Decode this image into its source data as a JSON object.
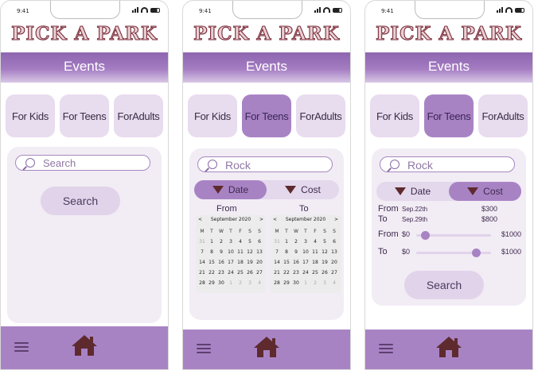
{
  "colors": {
    "header": "#a47cc2",
    "tab": "#e8dcef",
    "tab_active": "#a883c4",
    "card": "#f2ecf5",
    "footer": "#a883c4",
    "icon": "#5e2a2e"
  },
  "icons": [
    "search-icon",
    "triangle-down-icon",
    "menu-icon",
    "home-icon"
  ],
  "screens": [
    {
      "status_time": "9:41",
      "brand": "PICK A PARK",
      "header": "Events",
      "tabs": [
        "For Kids",
        "For Teens",
        "ForAdults"
      ],
      "active_tab": null,
      "search_value": "Search",
      "search_button": "Search"
    },
    {
      "status_time": "9:41",
      "brand": "PICK A PARK",
      "header": "Events",
      "tabs": [
        "For Kids",
        "For Teens",
        "ForAdults"
      ],
      "active_tab": 1,
      "search_value": "Rock",
      "filter": {
        "date": "Date",
        "cost": "Cost",
        "selected": "date"
      },
      "from_label": "From",
      "to_label": "To",
      "calendar": {
        "month": "September 2020",
        "weekdays": [
          "M",
          "T",
          "W",
          "T",
          "F",
          "S",
          "S"
        ],
        "days": [
          [
            "31",
            "1",
            "2",
            "3",
            "4",
            "5",
            "6"
          ],
          [
            "7",
            "8",
            "9",
            "10",
            "11",
            "12",
            "13"
          ],
          [
            "14",
            "15",
            "16",
            "17",
            "18",
            "19",
            "20"
          ],
          [
            "21",
            "22",
            "23",
            "24",
            "25",
            "26",
            "27"
          ],
          [
            "28",
            "29",
            "30",
            "1",
            "2",
            "3",
            "4"
          ]
        ]
      }
    },
    {
      "status_time": "9:41",
      "brand": "PICK A PARK",
      "header": "Events",
      "tabs": [
        "For Kids",
        "For Teens",
        "ForAdults"
      ],
      "active_tab": 1,
      "search_value": "Rock",
      "filter": {
        "date": "Date",
        "cost": "Cost",
        "selected": "cost"
      },
      "from_label": "From",
      "to_label": "To",
      "from_date": "Sep.22th",
      "to_date": "Sep.29th",
      "from_price": "$300",
      "to_price": "$800",
      "sliders": [
        {
          "label": "From",
          "min": "$0",
          "max": "$1000",
          "value": 0.12
        },
        {
          "label": "To",
          "min": "$0",
          "max": "$1000",
          "value": 0.8
        }
      ],
      "search_button": "Search"
    }
  ]
}
